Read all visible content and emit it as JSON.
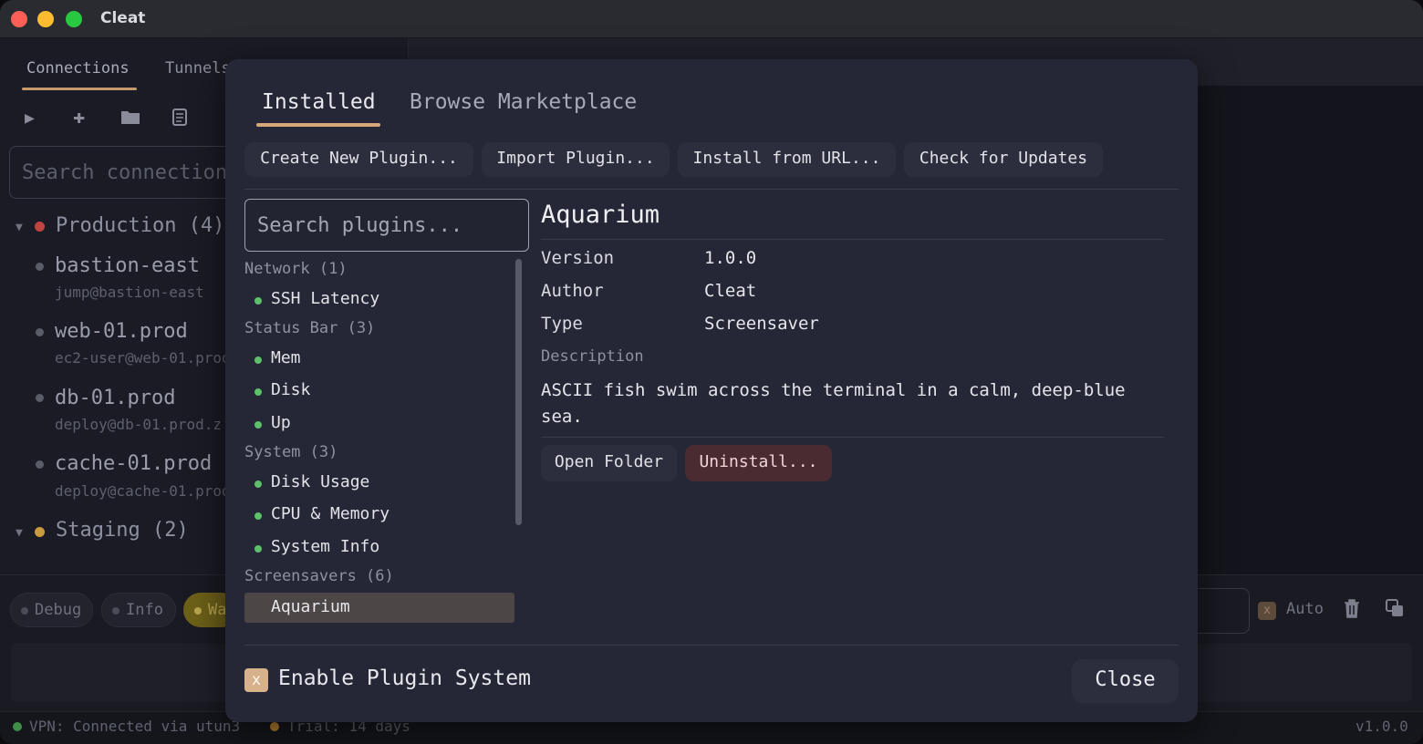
{
  "window": {
    "title": "Cleat"
  },
  "background": {
    "tabs": [
      "Connections",
      "Tunnels"
    ],
    "search_placeholder": "Search connections",
    "groups": [
      {
        "label": "Production (4)",
        "color": "#c0443f"
      },
      {
        "label": "Staging (2)",
        "color": "#c99a3e"
      }
    ],
    "hosts": [
      {
        "name": "bastion-east",
        "user": "jump@bastion-east"
      },
      {
        "name": "web-01.prod",
        "user": "ec2-user@web-01.prod"
      },
      {
        "name": "db-01.prod",
        "user": "deploy@db-01.prod.z"
      },
      {
        "name": "cache-01.prod",
        "user": "deploy@cache-01.prod"
      }
    ],
    "log_levels": [
      "Debug",
      "Info",
      "Wa"
    ],
    "auto_label": "Auto",
    "auto_checked_glyph": "x",
    "status": {
      "vpn": "VPN: Connected via utun3",
      "trial": "Trial: 14 days",
      "version": "v1.0.0"
    }
  },
  "modal": {
    "tabs": [
      {
        "label": "Installed",
        "active": true
      },
      {
        "label": "Browse Marketplace",
        "active": false
      }
    ],
    "actions": [
      "Create New Plugin...",
      "Import Plugin...",
      "Install from URL...",
      "Check for Updates"
    ],
    "search_placeholder": "Search plugins...",
    "categories": [
      {
        "label": "Network (1)",
        "plugins": [
          "SSH Latency"
        ]
      },
      {
        "label": "Status Bar (3)",
        "plugins": [
          "Mem",
          "Disk",
          "Up"
        ]
      },
      {
        "label": "System (3)",
        "plugins": [
          "Disk Usage",
          "CPU & Memory",
          "System Info"
        ]
      },
      {
        "label": "Screensavers (6)",
        "plugins": [
          "Aquarium"
        ]
      }
    ],
    "selected_plugin": "Aquarium",
    "details": {
      "title": "Aquarium",
      "fields": [
        {
          "key": "Version",
          "value": "1.0.0"
        },
        {
          "key": "Author",
          "value": "Cleat"
        },
        {
          "key": "Type",
          "value": "Screensaver"
        }
      ],
      "description_label": "Description",
      "description": "ASCII fish swim across the terminal in a calm, deep-blue sea.",
      "open_folder": "Open Folder",
      "uninstall": "Uninstall..."
    },
    "enable_label": "Enable Plugin System",
    "enable_checked_glyph": "x",
    "close_label": "Close",
    "colors": {
      "accent": "#d9a87a",
      "enabled_dot": "#5fbf6b",
      "danger_bg": "#4a2b31"
    }
  }
}
